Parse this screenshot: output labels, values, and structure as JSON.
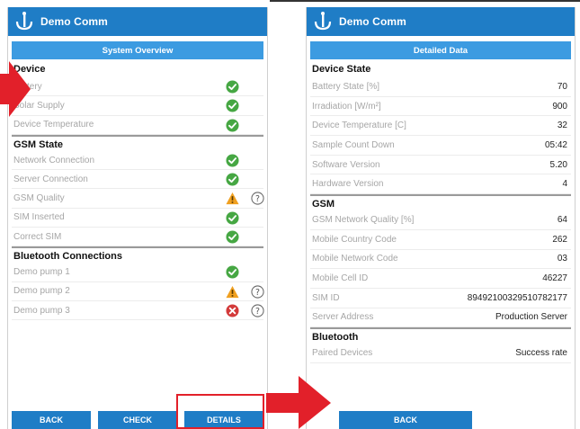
{
  "left_screen": {
    "app_title": "Demo Comm",
    "header": "System Overview",
    "sections": [
      {
        "title": "Device",
        "rows": [
          {
            "label": "Battery",
            "status": "ok"
          },
          {
            "label": "Solar Supply",
            "status": "ok"
          },
          {
            "label": "Device Temperature",
            "status": "ok"
          }
        ]
      },
      {
        "title": "GSM State",
        "rows": [
          {
            "label": "Network Connection",
            "status": "ok"
          },
          {
            "label": "Server Connection",
            "status": "ok"
          },
          {
            "label": "GSM Quality",
            "status": "warning",
            "help": true
          },
          {
            "label": "SIM Inserted",
            "status": "ok"
          },
          {
            "label": "Correct SIM",
            "status": "ok"
          }
        ]
      },
      {
        "title": "Bluetooth Connections",
        "rows": [
          {
            "label": "Demo pump 1",
            "status": "ok"
          },
          {
            "label": "Demo pump 2",
            "status": "warning",
            "help": true
          },
          {
            "label": "Demo pump 3",
            "status": "error",
            "help": true
          }
        ]
      }
    ],
    "buttons": [
      "BACK",
      "CHECK",
      "DETAILS"
    ]
  },
  "right_screen": {
    "app_title": "Demo Comm",
    "header": "Detailed Data",
    "sections": [
      {
        "title": "Device State",
        "rows": [
          {
            "label": "Battery State [%]",
            "value": "70"
          },
          {
            "label": "Irradiation [W/m²]",
            "value": "900"
          },
          {
            "label": "Device Temperature [C]",
            "value": "32"
          },
          {
            "label": "Sample Count Down",
            "value": "05:42"
          },
          {
            "label": "Software Version",
            "value": "5.20"
          },
          {
            "label": "Hardware Version",
            "value": "4"
          }
        ]
      },
      {
        "title": "GSM",
        "rows": [
          {
            "label": "GSM Network Quality [%]",
            "value": "64"
          },
          {
            "label": "Mobile Country Code",
            "value": "262"
          },
          {
            "label": "Mobile Network Code",
            "value": "03"
          },
          {
            "label": "Mobile Cell ID",
            "value": "46227"
          },
          {
            "label": "SIM ID",
            "value": "89492100329510782177"
          },
          {
            "label": "Server Address",
            "value": "Production Server"
          }
        ]
      },
      {
        "title": "Bluetooth",
        "rows": [
          {
            "label": "Paired Devices",
            "value": "Success rate"
          }
        ]
      }
    ],
    "buttons": [
      "BACK"
    ]
  },
  "colors": {
    "brand": "#1f7dc6",
    "subheader": "#3c9be1",
    "ok": "#46a743",
    "warning": "#f0a020",
    "error": "#d33a3a",
    "annotation": "#e2202a"
  },
  "icons": {
    "logo": "pump-tap-logo",
    "ok": "check-circle-icon",
    "warning": "warning-triangle-icon",
    "error": "x-circle-icon",
    "help": "question-circle-icon"
  }
}
